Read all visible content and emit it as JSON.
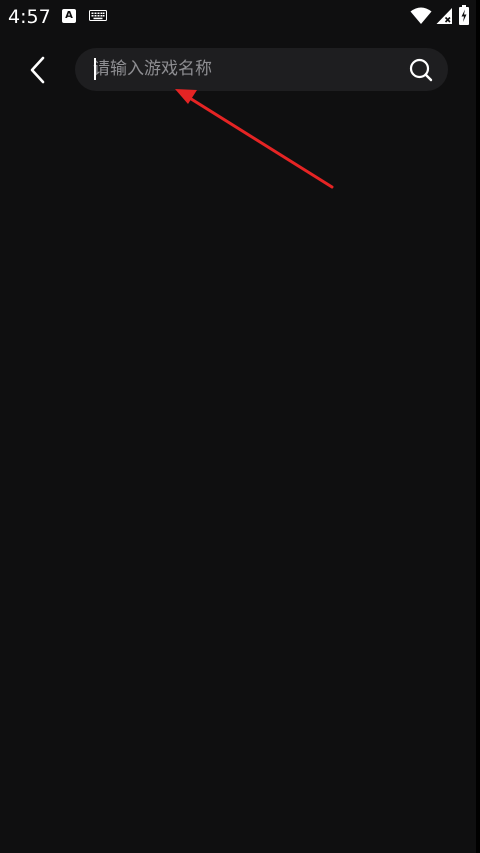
{
  "status_bar": {
    "time": "4:57",
    "notification_icon_letter": "A",
    "icons": [
      "a-notification-icon",
      "keyboard-icon",
      "wifi-icon",
      "signal-icon",
      "battery-charging-icon"
    ]
  },
  "header": {
    "back_icon": "chevron-left-icon",
    "search": {
      "placeholder": "请输入游戏名称",
      "value": "",
      "icon": "search-icon"
    }
  },
  "colors": {
    "background": "#0F0F10",
    "search_box": "#1E1E20",
    "placeholder": "#8E8E92",
    "annotation_arrow": "#E52424"
  }
}
